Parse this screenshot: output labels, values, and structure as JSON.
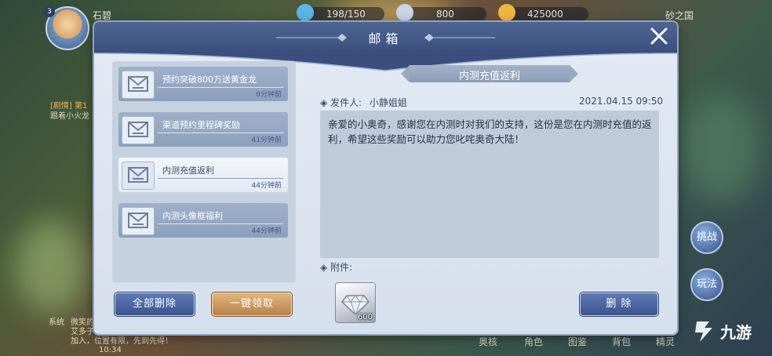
{
  "hud": {
    "level": "3",
    "player_name": "石碧",
    "stamina": "198/150",
    "diamonds": "800",
    "coins": "425000",
    "location": "砂之国",
    "quest_label": "[剧情] 第1",
    "quest_desc": "跟着小火龙",
    "chat_label": "系统",
    "chat_line1": "微笑的",
    "chat_line2": "艾多子",
    "chat_line3": "加入，位置有限，先到先得！",
    "clock": "10:34",
    "side_buttons": [
      "挑战",
      "玩法"
    ],
    "bottom_tabs": [
      "奥核",
      "角色",
      "图鉴",
      "背包",
      "精灵"
    ]
  },
  "modal": {
    "title": "邮箱",
    "mail_list": [
      {
        "title": "预约突破800万送黄金龙",
        "time": "8分钟前"
      },
      {
        "title": "渠道预约里程碑奖励",
        "time": "41分钟前"
      },
      {
        "title": "内测充值返利",
        "time": "44分钟前"
      },
      {
        "title": "内测头像框福利",
        "time": "44分钟前"
      }
    ],
    "active_index": 2,
    "delete_all_label": "全部删除",
    "claim_all_label": "一键领取",
    "subject": "内测充值返利",
    "sender_label": "◈ 发件人:",
    "sender_name": "小静姐姐",
    "date": "2021.04.15  09:50",
    "body": "亲爱的小奥奇，感谢您在内测时对我们的支持，这份是您在内测时充值的返利，希望这些奖励可以助力您叱咤奥奇大陆！",
    "attachment_label": "◈ 附件:",
    "attachment": {
      "icon": "diamond-icon",
      "count": "600"
    },
    "delete_label": "删 除"
  },
  "watermark": "九游",
  "colors": {
    "header": "#3a4f7d",
    "panel": "#d6dfec",
    "accent_blue": "#3b5590",
    "accent_gold": "#b9834a"
  }
}
